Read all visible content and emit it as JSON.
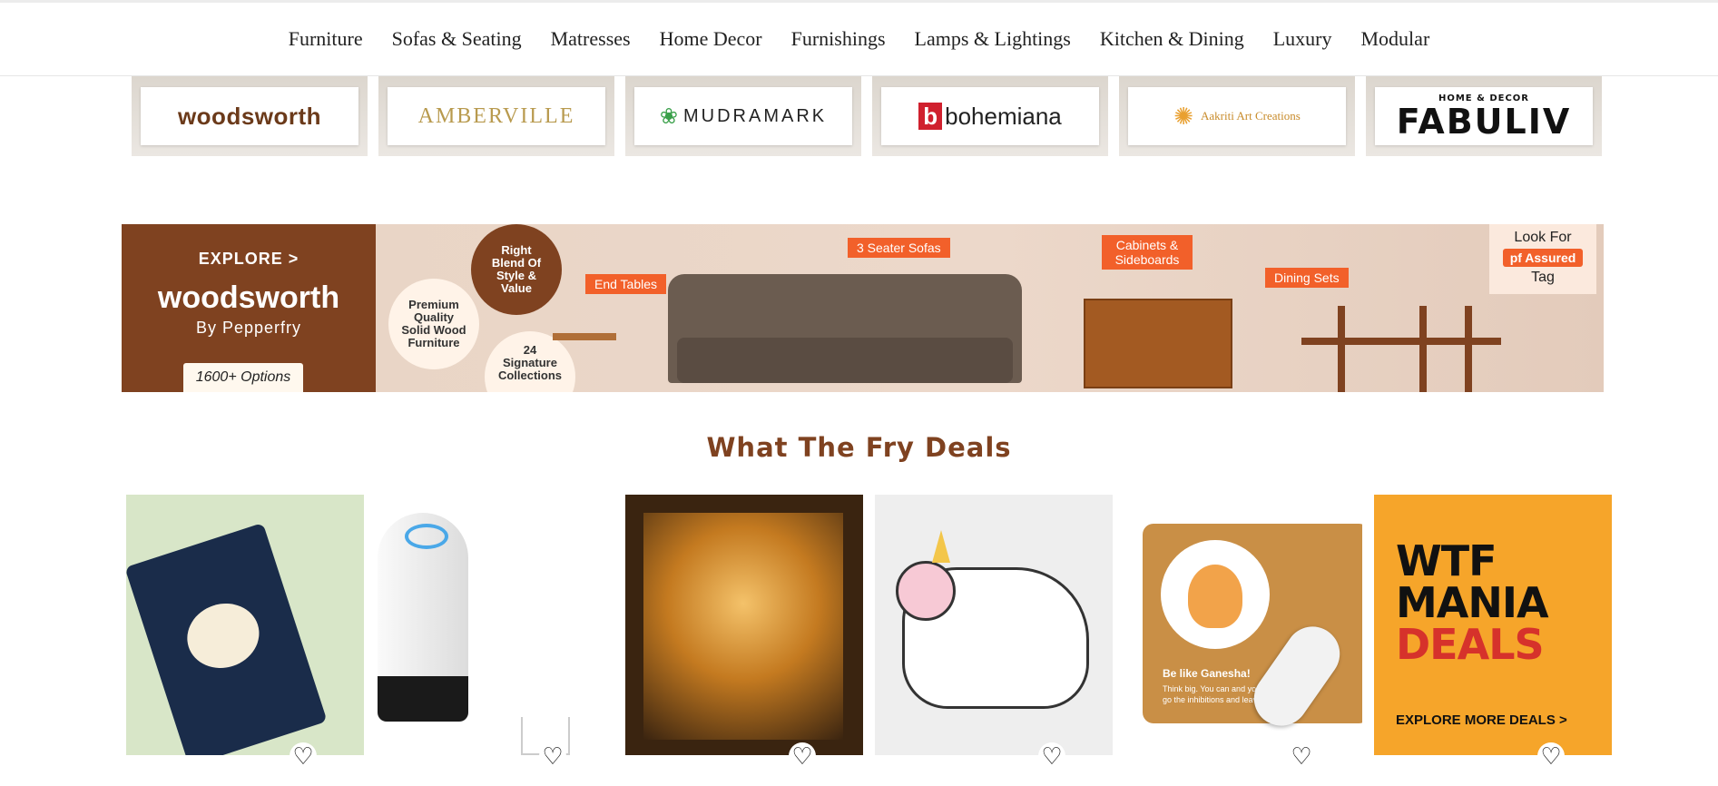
{
  "nav": {
    "items": [
      "Furniture",
      "Sofas & Seating",
      "Matresses",
      "Home Decor",
      "Furnishings",
      "Lamps & Lightings",
      "Kitchen & Dining",
      "Luxury",
      "Modular"
    ]
  },
  "brands": {
    "woodsworth": "woodsworth",
    "amberville": "AMBERVILLE",
    "mudramark": "MUDRAMARK",
    "bohemiana": "bohemiana",
    "aakriti": "Aakriti Art Creations",
    "fabuliv_top": "HOME & DECOR",
    "fabuliv": "FABULIV"
  },
  "banner": {
    "explore": "EXPLORE >",
    "brand": "woodsworth",
    "by": "By Pepperfry",
    "options": "1600+ Options",
    "blob1": "Right Blend Of Style & Value",
    "blob2": "Premium Quality Solid Wood Furniture",
    "blob3": "24 Signature Collections",
    "tag_end_tables": "End Tables",
    "tag_sofas": "3 Seater Sofas",
    "tag_cabinets": "Cabinets & Sideboards",
    "tag_dining": "Dining Sets",
    "assured_look": "Look For",
    "assured_pf": "pf Assured",
    "assured_tag": "Tag"
  },
  "section_title": "What The Fry Deals",
  "deals": {
    "ganesha_title": "Be like Ganesha!",
    "ganesha_text": "Think big. You can and you will! Let go the inhibitions and leave no space",
    "wtf_1": "WTF",
    "wtf_2": "MANIA",
    "wtf_3": "DEALS",
    "explore_more": "EXPLORE MORE DEALS >"
  }
}
